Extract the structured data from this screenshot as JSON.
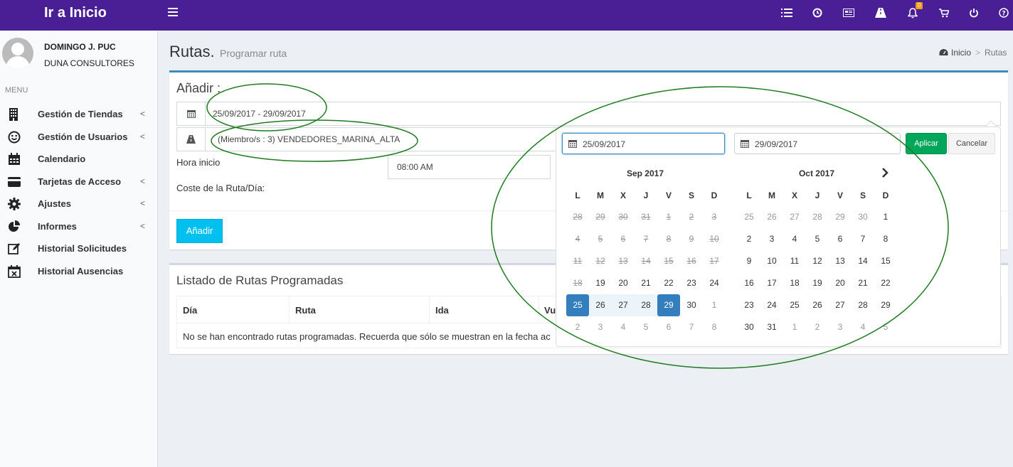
{
  "app": {
    "brand": "Ir a Inicio"
  },
  "topbar": {
    "icons": [
      "list-icon",
      "clock-icon",
      "newspaper-icon",
      "road-icon",
      "bell-icon",
      "cart-icon",
      "power-icon",
      "help-icon"
    ],
    "notification_count": "0"
  },
  "user": {
    "name": "DOMINGO J. PUC",
    "company": "DUNA CONSULTORES"
  },
  "sidebar": {
    "header": "MENU",
    "items": [
      {
        "label": "Gestión de Tiendas",
        "icon": "building-icon",
        "has_chevron": true
      },
      {
        "label": "Gestión de Usuarios",
        "icon": "smile-icon",
        "has_chevron": true
      },
      {
        "label": "Calendario",
        "icon": "calendar-icon",
        "has_chevron": false
      },
      {
        "label": "Tarjetas de Acceso",
        "icon": "credit-card-icon",
        "has_chevron": true
      },
      {
        "label": "Ajustes",
        "icon": "gear-icon",
        "has_chevron": true
      },
      {
        "label": "Informes",
        "icon": "pie-chart-icon",
        "has_chevron": true
      },
      {
        "label": "Historial Solicitudes",
        "icon": "edit-icon",
        "has_chevron": false
      },
      {
        "label": "Historial Ausencias",
        "icon": "calendar-x-icon",
        "has_chevron": false
      }
    ],
    "chevron": "<"
  },
  "page": {
    "title": "Rutas.",
    "subtitle": "Programar ruta",
    "breadcrumb": {
      "home": "Inicio",
      "sep": ">",
      "current": "Rutas"
    }
  },
  "form": {
    "title": "Añadir :",
    "date_range": "25/09/2017 - 29/09/2017",
    "members": "(Miembro/s : 3) VENDEDORES_MARINA_ALTA",
    "hora_inicio_label": "Hora inicio",
    "hora_inicio_value": "08:00 AM",
    "coste_label": "Coste de la Ruta/Día:",
    "add_button": "Añadir"
  },
  "listado": {
    "title": "Listado de Rutas Programadas",
    "columns": [
      "Día",
      "Ruta",
      "Ida",
      "Vu"
    ],
    "empty_message": "No se han encontrado rutas programadas. Recuerda que sólo se muestran en la fecha ac"
  },
  "daterangepicker": {
    "start_input": "25/09/2017",
    "end_input": "29/09/2017",
    "apply": "Aplicar",
    "cancel": "Cancelar",
    "weekdays": [
      "L",
      "M",
      "X",
      "J",
      "V",
      "S",
      "D"
    ],
    "left": {
      "title": "Sep 2017",
      "weeks": [
        [
          [
            "28",
            "dis"
          ],
          [
            "29",
            "dis"
          ],
          [
            "30",
            "dis"
          ],
          [
            "31",
            "dis"
          ],
          [
            "1",
            "dis"
          ],
          [
            "2",
            "dis"
          ],
          [
            "3",
            "dis"
          ]
        ],
        [
          [
            "4",
            "dis"
          ],
          [
            "5",
            "dis"
          ],
          [
            "6",
            "dis"
          ],
          [
            "7",
            "dis"
          ],
          [
            "8",
            "dis"
          ],
          [
            "9",
            "dis"
          ],
          [
            "10",
            "dis"
          ]
        ],
        [
          [
            "11",
            "dis"
          ],
          [
            "12",
            "dis"
          ],
          [
            "13",
            "dis"
          ],
          [
            "14",
            "dis"
          ],
          [
            "15",
            "dis"
          ],
          [
            "16",
            "dis"
          ],
          [
            "17",
            "dis"
          ]
        ],
        [
          [
            "18",
            "dis"
          ],
          [
            "19",
            ""
          ],
          [
            "20",
            ""
          ],
          [
            "21",
            ""
          ],
          [
            "22",
            ""
          ],
          [
            "23",
            ""
          ],
          [
            "24",
            ""
          ]
        ],
        [
          [
            "25",
            "act"
          ],
          [
            "26",
            "inr"
          ],
          [
            "27",
            "inr"
          ],
          [
            "28",
            "inr"
          ],
          [
            "29",
            "act"
          ],
          [
            "30",
            ""
          ],
          [
            "1",
            "off"
          ]
        ],
        [
          [
            "2",
            "off"
          ],
          [
            "3",
            "off"
          ],
          [
            "4",
            "off"
          ],
          [
            "5",
            "off"
          ],
          [
            "6",
            "off"
          ],
          [
            "7",
            "off"
          ],
          [
            "8",
            "off"
          ]
        ]
      ]
    },
    "right": {
      "title": "Oct 2017",
      "weeks": [
        [
          [
            "25",
            "off"
          ],
          [
            "26",
            "off"
          ],
          [
            "27",
            "off"
          ],
          [
            "28",
            "off"
          ],
          [
            "29",
            "off"
          ],
          [
            "30",
            "off"
          ],
          [
            "1",
            ""
          ]
        ],
        [
          [
            "2",
            ""
          ],
          [
            "3",
            ""
          ],
          [
            "4",
            ""
          ],
          [
            "5",
            ""
          ],
          [
            "6",
            ""
          ],
          [
            "7",
            ""
          ],
          [
            "8",
            ""
          ]
        ],
        [
          [
            "9",
            ""
          ],
          [
            "10",
            ""
          ],
          [
            "11",
            ""
          ],
          [
            "12",
            ""
          ],
          [
            "13",
            ""
          ],
          [
            "14",
            ""
          ],
          [
            "15",
            ""
          ]
        ],
        [
          [
            "16",
            ""
          ],
          [
            "17",
            ""
          ],
          [
            "18",
            ""
          ],
          [
            "19",
            ""
          ],
          [
            "20",
            ""
          ],
          [
            "21",
            ""
          ],
          [
            "22",
            ""
          ]
        ],
        [
          [
            "23",
            ""
          ],
          [
            "24",
            ""
          ],
          [
            "25",
            ""
          ],
          [
            "26",
            ""
          ],
          [
            "27",
            ""
          ],
          [
            "28",
            ""
          ],
          [
            "29",
            ""
          ]
        ],
        [
          [
            "30",
            ""
          ],
          [
            "31",
            ""
          ],
          [
            "1",
            "off"
          ],
          [
            "2",
            "off"
          ],
          [
            "3",
            "off"
          ],
          [
            "4",
            "off"
          ],
          [
            "5",
            "off"
          ]
        ]
      ]
    }
  },
  "colors": {
    "topbar": "#4a1f96",
    "accent": "#3c8dbc",
    "apply": "#00a65a",
    "add": "#00c0ef",
    "annotation": "#1e7a1e"
  }
}
